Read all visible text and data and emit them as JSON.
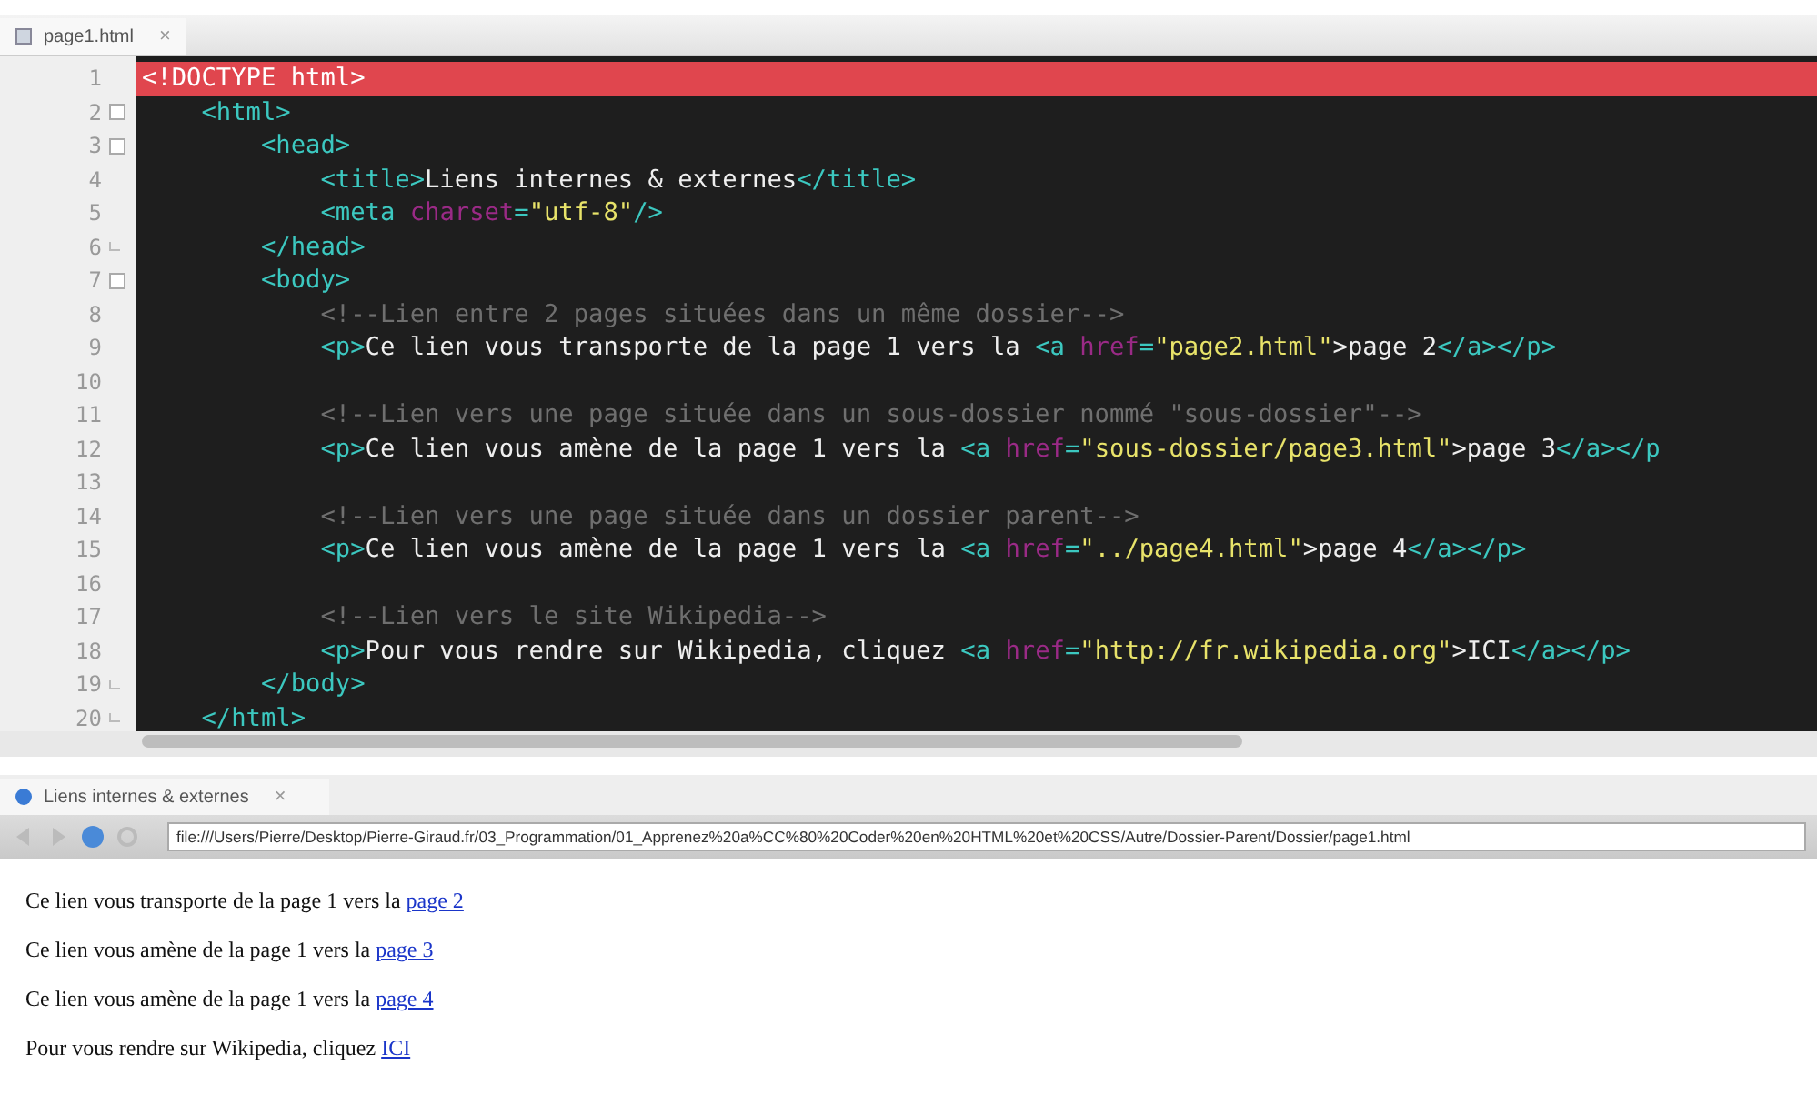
{
  "editor": {
    "tab": {
      "label": "page1.html",
      "close": "×"
    },
    "lines": [
      {
        "number": "1",
        "kind": "plain",
        "highlighted": true,
        "tokens": [
          {
            "kind": "doctype",
            "text": "<!DOCTYPE html>"
          }
        ]
      },
      {
        "number": "2",
        "kind": "opener",
        "highlighted": false,
        "tokens": [
          {
            "kind": "tag",
            "text": "    <html>"
          }
        ]
      },
      {
        "number": "3",
        "kind": "opener",
        "highlighted": false,
        "tokens": [
          {
            "kind": "tag",
            "text": "        <head>"
          }
        ]
      },
      {
        "number": "4",
        "kind": "plain",
        "highlighted": false,
        "tokens": [
          {
            "kind": "tag",
            "text": "            <title>"
          },
          {
            "kind": "text",
            "text": "Liens internes & externes"
          },
          {
            "kind": "tag",
            "text": "</title>"
          }
        ]
      },
      {
        "number": "5",
        "kind": "plain",
        "highlighted": false,
        "tokens": [
          {
            "kind": "tag",
            "text": "            <meta "
          },
          {
            "kind": "attr",
            "text": "charset"
          },
          {
            "kind": "tag",
            "text": "="
          },
          {
            "kind": "string",
            "text": "\"utf-8\""
          },
          {
            "kind": "tag",
            "text": "/>"
          }
        ]
      },
      {
        "number": "6",
        "kind": "closer",
        "highlighted": false,
        "tokens": [
          {
            "kind": "tag",
            "text": "        </head>"
          }
        ]
      },
      {
        "number": "7",
        "kind": "opener",
        "highlighted": false,
        "tokens": [
          {
            "kind": "tag",
            "text": "        <body>"
          }
        ]
      },
      {
        "number": "8",
        "kind": "plain",
        "highlighted": false,
        "tokens": [
          {
            "kind": "comment",
            "text": "            <!--Lien entre 2 pages situées dans un même dossier-->"
          }
        ]
      },
      {
        "number": "9",
        "kind": "plain",
        "highlighted": false,
        "tokens": [
          {
            "kind": "tag",
            "text": "            <p>"
          },
          {
            "kind": "text",
            "text": "Ce lien vous transporte de la page 1 vers la "
          },
          {
            "kind": "tag",
            "text": "<a "
          },
          {
            "kind": "attr",
            "text": "href"
          },
          {
            "kind": "tag",
            "text": "="
          },
          {
            "kind": "string",
            "text": "\"page2.html\""
          },
          {
            "kind": "text",
            "text": ">page 2"
          },
          {
            "kind": "tag",
            "text": "</a></p>"
          }
        ]
      },
      {
        "number": "10",
        "kind": "plain",
        "highlighted": false
      },
      {
        "number": "11",
        "kind": "plain",
        "highlighted": false,
        "tokens": [
          {
            "kind": "comment",
            "text": "            <!--Lien vers une page située dans un sous-dossier nommé \"sous-dossier\"-->"
          }
        ]
      },
      {
        "number": "12",
        "kind": "plain",
        "highlighted": false,
        "tokens": [
          {
            "kind": "tag",
            "text": "            <p>"
          },
          {
            "kind": "text",
            "text": "Ce lien vous amène de la page 1 vers la "
          },
          {
            "kind": "tag",
            "text": "<a "
          },
          {
            "kind": "attr",
            "text": "href"
          },
          {
            "kind": "tag",
            "text": "="
          },
          {
            "kind": "string",
            "text": "\"sous-dossier/page3.html\""
          },
          {
            "kind": "text",
            "text": ">page 3"
          },
          {
            "kind": "tag",
            "text": "</a></p"
          }
        ]
      },
      {
        "number": "13",
        "kind": "plain",
        "highlighted": false
      },
      {
        "number": "14",
        "kind": "plain",
        "highlighted": false,
        "tokens": [
          {
            "kind": "comment",
            "text": "            <!--Lien vers une page située dans un dossier parent-->"
          }
        ]
      },
      {
        "number": "15",
        "kind": "plain",
        "highlighted": false,
        "tokens": [
          {
            "kind": "tag",
            "text": "            <p>"
          },
          {
            "kind": "text",
            "text": "Ce lien vous amène de la page 1 vers la "
          },
          {
            "kind": "tag",
            "text": "<a "
          },
          {
            "kind": "attr",
            "text": "href"
          },
          {
            "kind": "tag",
            "text": "="
          },
          {
            "kind": "string",
            "text": "\"../page4.html\""
          },
          {
            "kind": "text",
            "text": ">page 4"
          },
          {
            "kind": "tag",
            "text": "</a></p>"
          }
        ]
      },
      {
        "number": "16",
        "kind": "plain",
        "highlighted": false
      },
      {
        "number": "17",
        "kind": "plain",
        "highlighted": false,
        "tokens": [
          {
            "kind": "comment",
            "text": "            <!--Lien vers le site Wikipedia-->"
          }
        ]
      },
      {
        "number": "18",
        "kind": "plain",
        "highlighted": false,
        "tokens": [
          {
            "kind": "tag",
            "text": "            <p>"
          },
          {
            "kind": "text",
            "text": "Pour vous rendre sur Wikipedia, cliquez "
          },
          {
            "kind": "tag",
            "text": "<a "
          },
          {
            "kind": "attr",
            "text": "href"
          },
          {
            "kind": "tag",
            "text": "="
          },
          {
            "kind": "string",
            "text": "\"http://fr.wikipedia.org\""
          },
          {
            "kind": "text",
            "text": ">ICI"
          },
          {
            "kind": "tag",
            "text": "</a></p>"
          }
        ]
      },
      {
        "number": "19",
        "kind": "closer",
        "highlighted": false,
        "tokens": [
          {
            "kind": "tag",
            "text": "        </body>"
          }
        ]
      },
      {
        "number": "20",
        "kind": "closer",
        "highlighted": false,
        "tokens": [
          {
            "kind": "tag",
            "text": "    </html>"
          }
        ]
      }
    ]
  },
  "browser": {
    "tab": {
      "label": "Liens internes & externes",
      "close": "×"
    },
    "url": "file:///Users/Pierre/Desktop/Pierre-Giraud.fr/03_Programmation/01_Apprenez%20a%CC%80%20Coder%20en%20HTML%20et%20CSS/Autre/Dossier-Parent/Dossier/page1.html",
    "paragraphs": [
      {
        "text": "Ce lien vous transporte de la page 1 vers la ",
        "link": "page 2"
      },
      {
        "text": "Ce lien vous amène de la page 1 vers la ",
        "link": "page 3"
      },
      {
        "text": "Ce lien vous amène de la page 1 vers la ",
        "link": "page 4"
      },
      {
        "text": "Pour vous rendre sur Wikipedia, cliquez ",
        "link": "ICI"
      }
    ]
  }
}
